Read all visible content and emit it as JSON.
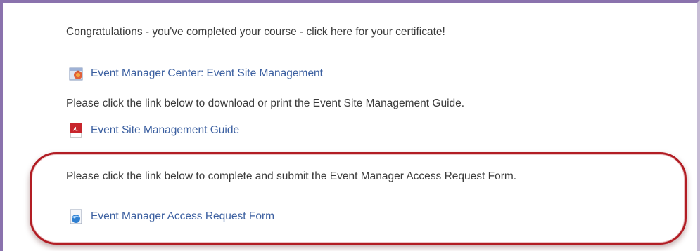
{
  "course": {
    "congrats_text": "Congratulations - you've completed your course - click here for your certificate!"
  },
  "center_link": {
    "label": "Event Manager Center: Event Site Management",
    "icon": "event-center-icon"
  },
  "guide_section": {
    "instruction": "Please click the link below to download or print the Event Site Management Guide.",
    "link_label": "Event Site Management Guide",
    "icon": "pdf-icon"
  },
  "access_section": {
    "instruction": "Please click the link below to complete and submit the Event Manager Access Request Form.",
    "link_label": "Event Manager Access Request Form",
    "icon": "globe-document-icon"
  },
  "colors": {
    "link": "#3b5fa0",
    "text": "#3a3a3a",
    "frame": "#8a72ad",
    "highlight": "#b21d24"
  }
}
